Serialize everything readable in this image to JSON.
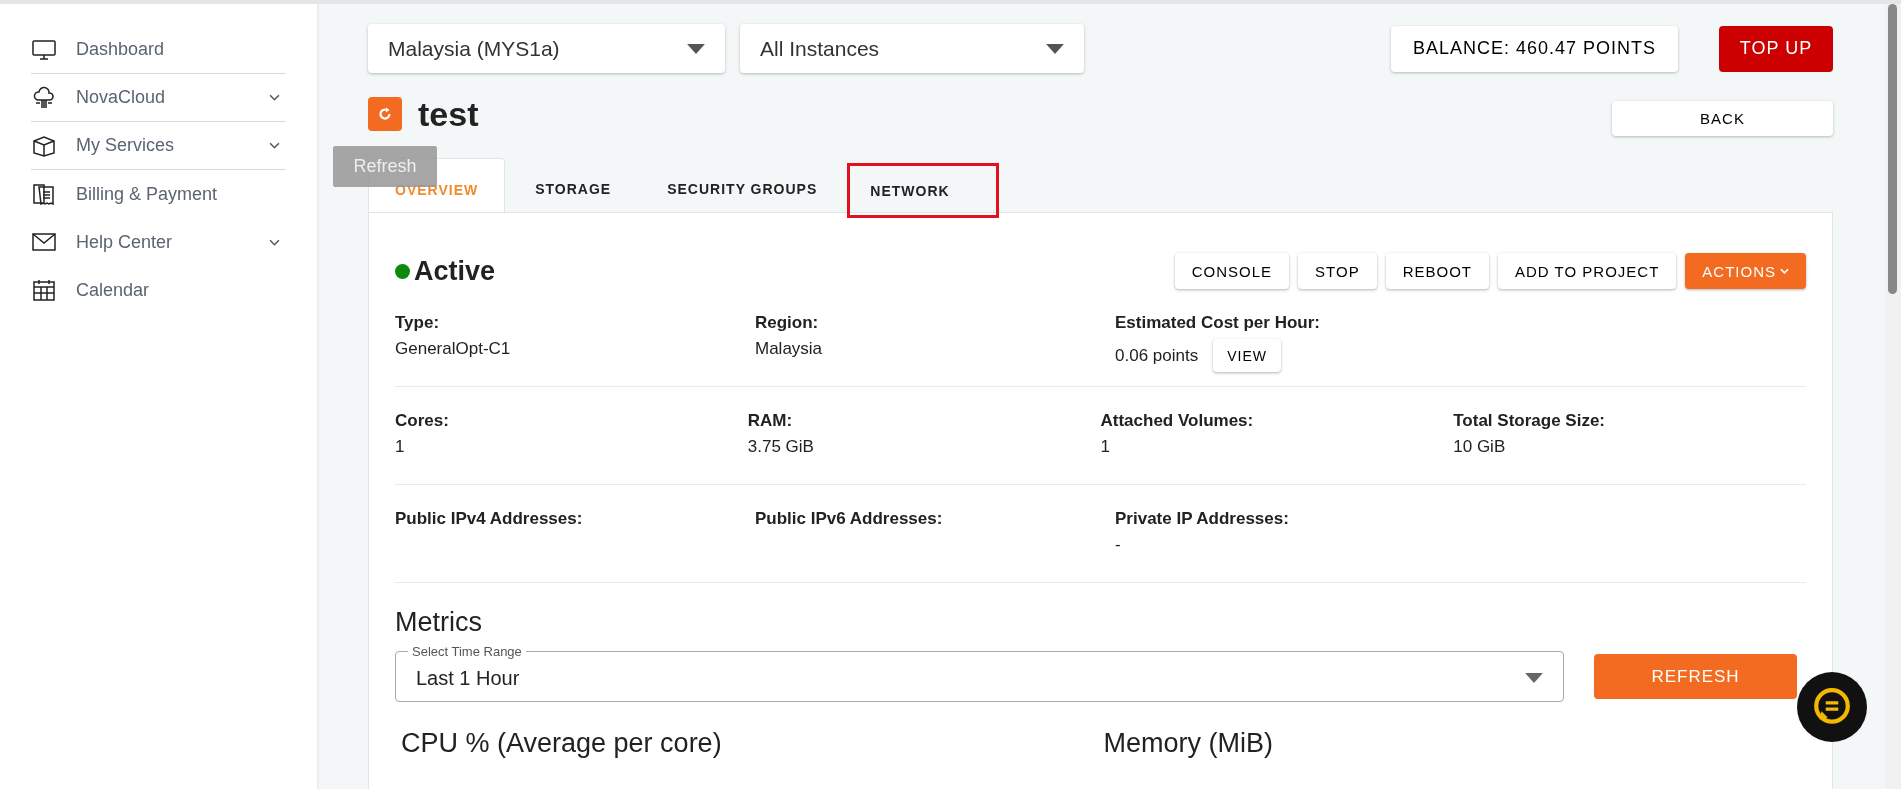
{
  "sidebar": {
    "items": [
      {
        "label": "Dashboard",
        "has_submenu": false
      },
      {
        "label": "NovaCloud",
        "has_submenu": true
      },
      {
        "label": "My Services",
        "has_submenu": true
      },
      {
        "label": "Billing & Payment",
        "has_submenu": false
      },
      {
        "label": "Help Center",
        "has_submenu": true
      },
      {
        "label": "Calendar",
        "has_submenu": false
      }
    ]
  },
  "filters": [
    {
      "value": "Malaysia (MYS1a)"
    },
    {
      "value": "All Instances"
    }
  ],
  "balance_button": "BALANCE: 460.47 POINTS",
  "top_up_button": "TOP UP",
  "instance": {
    "name": "test",
    "refresh_tooltip": "Refresh"
  },
  "back_button": "BACK",
  "tabs": [
    {
      "label": "OVERVIEW",
      "selected": true,
      "highlighted": false
    },
    {
      "label": "STORAGE",
      "selected": false,
      "highlighted": false
    },
    {
      "label": "SECURITY GROUPS",
      "selected": false,
      "highlighted": false
    },
    {
      "label": "NETWORK",
      "selected": false,
      "highlighted": true
    }
  ],
  "status": {
    "label": "Active"
  },
  "actions": [
    {
      "label": "CONSOLE",
      "kind": "plain"
    },
    {
      "label": "STOP",
      "kind": "plain"
    },
    {
      "label": "REBOOT",
      "kind": "plain"
    },
    {
      "label": "ADD TO PROJECT",
      "kind": "plain"
    },
    {
      "label": "ACTIONS",
      "kind": "menu"
    }
  ],
  "details": [
    [
      {
        "label": "Type:",
        "value": "GeneralOpt-C1"
      },
      {
        "label": "Region:",
        "value": "Malaysia"
      },
      {
        "label": "Estimated Cost per Hour:",
        "value": "0.06 points",
        "button": "VIEW"
      }
    ],
    [
      {
        "label": "Cores:",
        "value": "1"
      },
      {
        "label": "RAM:",
        "value": "3.75 GiB"
      },
      {
        "label": "Attached Volumes:",
        "value": "1"
      },
      {
        "label": "Total Storage Size:",
        "value": "10 GiB"
      }
    ],
    [
      {
        "label": "Public IPv4 Addresses:"
      },
      {
        "label": "Public IPv6 Addresses:"
      },
      {
        "label": "Private IP Addresses:",
        "value": "-"
      }
    ]
  ],
  "metrics": {
    "title": "Metrics",
    "time_range": {
      "label": "Select Time Range",
      "value": "Last 1 Hour"
    },
    "refresh_button": "REFRESH",
    "charts": [
      {
        "title": "CPU % (Average per core)"
      },
      {
        "title": "Memory (MiB)"
      }
    ]
  }
}
